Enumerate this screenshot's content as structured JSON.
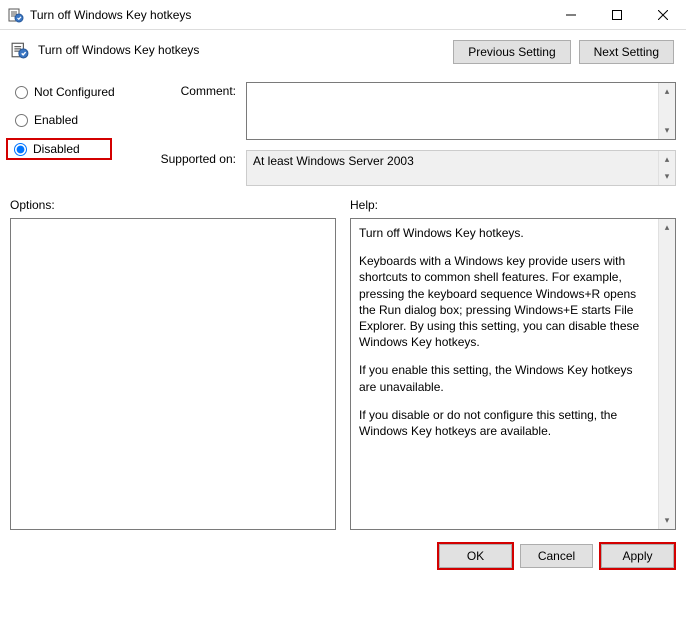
{
  "window": {
    "title": "Turn off Windows Key hotkeys"
  },
  "header": {
    "title": "Turn off Windows Key hotkeys",
    "prev_btn": "Previous Setting",
    "next_btn": "Next Setting"
  },
  "radios": {
    "not_configured": "Not Configured",
    "enabled": "Enabled",
    "disabled": "Disabled"
  },
  "fields": {
    "comment_label": "Comment:",
    "comment_value": "",
    "supported_label": "Supported on:",
    "supported_value": "At least Windows Server 2003"
  },
  "panels": {
    "options_label": "Options:",
    "help_label": "Help:",
    "help_paragraphs": {
      "p1": "Turn off Windows Key hotkeys.",
      "p2": "Keyboards with a Windows key provide users with shortcuts to common shell features. For example, pressing the keyboard sequence Windows+R opens the Run dialog box; pressing Windows+E starts File Explorer. By using this setting, you can disable these Windows Key hotkeys.",
      "p3": "If you enable this setting, the Windows Key hotkeys are unavailable.",
      "p4": "If you disable or do not configure this setting, the Windows Key hotkeys are available."
    }
  },
  "footer": {
    "ok": "OK",
    "cancel": "Cancel",
    "apply": "Apply"
  }
}
